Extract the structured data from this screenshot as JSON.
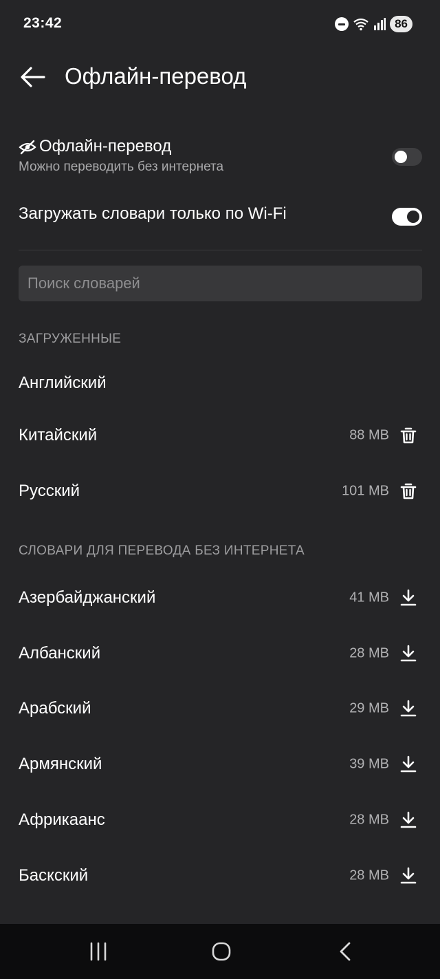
{
  "status_bar": {
    "time": "23:42",
    "battery": "86"
  },
  "header": {
    "title": "Офлайн-перевод"
  },
  "offline_setting": {
    "title": "Офлайн-перевод",
    "subtitle": "Можно переводить без интернета",
    "enabled": false
  },
  "wifi_setting": {
    "title": "Загружать словари только по Wi-Fi",
    "enabled": true
  },
  "search": {
    "placeholder": "Поиск словарей",
    "value": ""
  },
  "downloaded": {
    "header": "ЗАГРУЖЕННЫЕ",
    "items": [
      {
        "name": "Английский",
        "size": ""
      },
      {
        "name": "Китайский",
        "size": "88 MB"
      },
      {
        "name": "Русский",
        "size": "101 MB"
      }
    ]
  },
  "available": {
    "header": "СЛОВАРИ ДЛЯ ПЕРЕВОДА БЕЗ ИНТЕРНЕТА",
    "items": [
      {
        "name": "Азербайджанский",
        "size": "41 MB"
      },
      {
        "name": "Албанский",
        "size": "28 MB"
      },
      {
        "name": "Арабский",
        "size": "29 MB"
      },
      {
        "name": "Армянский",
        "size": "39 MB"
      },
      {
        "name": "Африкаанс",
        "size": "28 MB"
      },
      {
        "name": "Баскский",
        "size": "28 MB"
      }
    ]
  },
  "icons": {
    "back": "arrow-left-icon",
    "offline": "eye-off-icon",
    "delete": "trash-icon",
    "download": "download-icon",
    "nav_recents": "recents-icon",
    "nav_home": "home-icon",
    "nav_back": "chevron-left-icon"
  },
  "colors": {
    "background": "#252527",
    "text": "#ffffff",
    "secondary_text": "#a9a9ab",
    "nav_bar": "#0c0c0d"
  }
}
